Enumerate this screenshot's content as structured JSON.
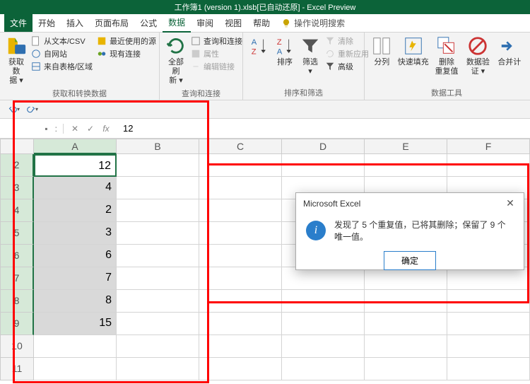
{
  "title": "工作簿1 (version 1).xlsb[已自动还原]  -  Excel Preview",
  "menu": {
    "file": "文件",
    "home": "开始",
    "insert": "插入",
    "layout": "页面布局",
    "formula": "公式",
    "data": "数据",
    "review": "审阅",
    "view": "视图",
    "help": "帮助",
    "search": "操作说明搜索"
  },
  "ribbon": {
    "g1": {
      "get": "获取数\n据 ▾",
      "csv": "从文本/CSV",
      "web": "自网站",
      "table": "来自表格/区域",
      "recent": "最近使用的源",
      "conn": "现有连接",
      "label": "获取和转换数据"
    },
    "g2": {
      "refresh": "全部刷\n新 ▾",
      "qc": "查询和连接",
      "prop": "属性",
      "edit": "编辑链接",
      "label": "查询和连接"
    },
    "g3": {
      "sort": "排序",
      "filter": "筛选\n▾",
      "clear": "清除",
      "reapply": "重新应用",
      "adv": "高级",
      "label": "排序和筛选"
    },
    "g4": {
      "ttc": "分列",
      "flash": "快速填充",
      "dup": "删除\n重复值",
      "valid": "数据验\n证 ▾",
      "merge": "合并计",
      "label": "数据工具"
    }
  },
  "formula": {
    "name": "",
    "fx": "fx",
    "value": "12"
  },
  "cols": [
    "A",
    "B",
    "C",
    "D",
    "E",
    "F"
  ],
  "rowsStart": 2,
  "cells": [
    "12",
    "4",
    "2",
    "3",
    "6",
    "7",
    "8",
    "15",
    "",
    ""
  ],
  "dialog": {
    "title": "Microsoft Excel",
    "msg": "发现了 5 个重复值，已将其删除；保留了 9 个唯一值。",
    "ok": "确定"
  }
}
